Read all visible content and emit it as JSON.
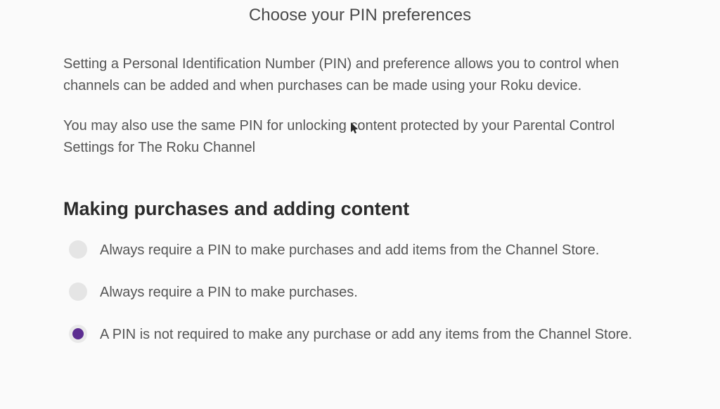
{
  "header": {
    "title": "Choose your PIN preferences"
  },
  "intro": {
    "paragraph1": "Setting a Personal Identification Number (PIN) and preference allows you to control when channels can be added and when purchases can be made using your Roku device.",
    "paragraph2": "You may also use the same PIN for unlocking content protected by your Parental Control Settings for The Roku Channel"
  },
  "section": {
    "heading": "Making purchases and adding content",
    "options": [
      {
        "label": "Always require a PIN to make purchases and add items from the Channel Store.",
        "selected": false
      },
      {
        "label": "Always require a PIN to make purchases.",
        "selected": false
      },
      {
        "label": "A PIN is not required to make any purchase or add any items from the Channel Store.",
        "selected": true
      }
    ]
  },
  "colors": {
    "accent": "#5c2d91",
    "text": "#555",
    "heading": "#2b2b2b"
  }
}
